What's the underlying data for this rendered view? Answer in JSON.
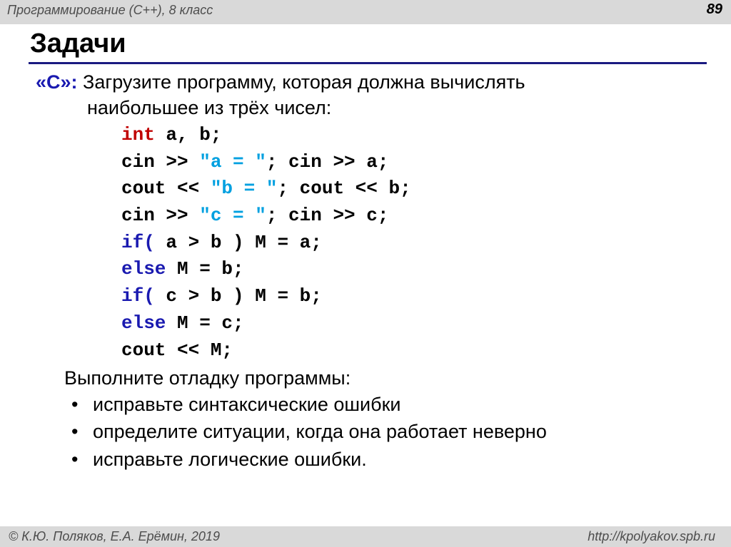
{
  "header": {
    "course": "Программирование (С++), 8 класс",
    "page_number": "89"
  },
  "slide": {
    "title": "Задачи",
    "task": {
      "label": "«C»:",
      "line1": " Загрузите программу, которая должна вычислять",
      "line2": "наибольшее из трёх чисел:"
    },
    "code": [
      [
        {
          "t": "int",
          "c": "type"
        },
        {
          "t": " a, b;",
          "c": ""
        }
      ],
      [
        {
          "t": "cin >> ",
          "c": ""
        },
        {
          "t": "\"a = \"",
          "c": "str"
        },
        {
          "t": "; cin >> a;",
          "c": ""
        }
      ],
      [
        {
          "t": "cout << ",
          "c": ""
        },
        {
          "t": "\"b = \"",
          "c": "str"
        },
        {
          "t": "; cout << b;",
          "c": ""
        }
      ],
      [
        {
          "t": "cin >> ",
          "c": ""
        },
        {
          "t": "\"c = \"",
          "c": "str"
        },
        {
          "t": "; cin >> c;",
          "c": ""
        }
      ],
      [
        {
          "t": "if(",
          "c": "kw"
        },
        {
          "t": " a > b ) M = a;",
          "c": ""
        }
      ],
      [
        {
          "t": "else",
          "c": "kw"
        },
        {
          "t": " M = b;",
          "c": ""
        }
      ],
      [
        {
          "t": "if(",
          "c": "kw"
        },
        {
          "t": " c > b ) M = b;",
          "c": ""
        }
      ],
      [
        {
          "t": "else",
          "c": "kw"
        },
        {
          "t": " M = c;",
          "c": ""
        }
      ],
      [
        {
          "t": "cout << M;",
          "c": ""
        }
      ]
    ],
    "debug_heading": "Выполните отладку программы:",
    "bullet_symbol": "•",
    "bullets": [
      "исправьте синтаксические ошибки",
      "определите ситуации, когда она работает неверно",
      "исправьте логические ошибки."
    ]
  },
  "footer": {
    "copyright": "© К.Ю. Поляков, Е.А. Ерёмин, 2019",
    "url": "http://kpolyakov.spb.ru"
  },
  "colors": {
    "bar_background": "#d9d9d9",
    "title_rule": "#1a1a80",
    "task_label": "#1a1ab0",
    "keyword_type": "#c00000",
    "keyword": "#1a1ab0",
    "string_literal": "#00a0e0"
  }
}
